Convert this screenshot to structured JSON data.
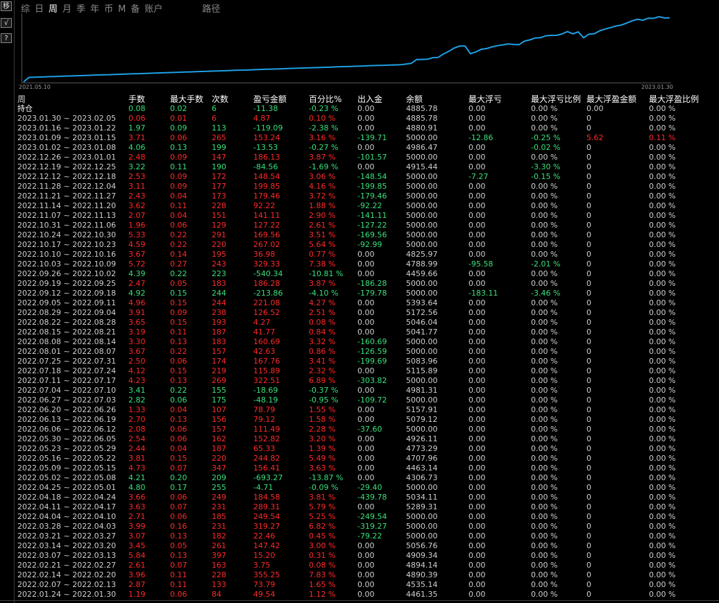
{
  "side_buttons": [
    "移",
    "√",
    "?"
  ],
  "tabs": [
    {
      "label": "综",
      "active": false
    },
    {
      "label": "日",
      "active": false
    },
    {
      "label": "周",
      "active": true
    },
    {
      "label": "月",
      "active": false
    },
    {
      "label": "季",
      "active": false
    },
    {
      "label": "年",
      "active": false
    },
    {
      "label": "币",
      "active": false
    },
    {
      "label": "M",
      "active": false
    },
    {
      "label": "备",
      "active": false
    },
    {
      "label": "账户",
      "active": false
    },
    {
      "label": "路径",
      "active": false
    }
  ],
  "chart": {
    "start_date": "2021.05.10",
    "end_date": "2023.01.30",
    "line_color": "#1ea0e6"
  },
  "columns": [
    "周",
    "手数",
    "最大手数",
    "次数",
    "盈亏金额",
    "百分比%",
    "出入金",
    "余额",
    "最大浮亏",
    "最大浮亏比例",
    "最大浮盈金额",
    "最大浮盈比例"
  ],
  "holding": {
    "label": "持仓",
    "lots": "0.08",
    "max_lots": "0.02",
    "count": "6",
    "pnl": "-11.38",
    "pct": "-0.23 %",
    "flow": "0.00",
    "balance": "4885.78",
    "max_float_loss": "0.00",
    "max_float_loss_pct": "0.00 %",
    "max_float_profit": "0.00",
    "max_float_profit_pct": "0.00 %",
    "color": "neg"
  },
  "rows": [
    [
      "2023.01.30 ~ 2023.02.05",
      "0.06",
      "0.01",
      "6",
      "4.87",
      "0.10 %",
      "0.00",
      "4885.78",
      "0.00",
      "0.00 %",
      "0",
      "0.00 %"
    ],
    [
      "2023.01.16 ~ 2023.01.22",
      "1.97",
      "0.09",
      "113",
      "-119.09",
      "-2.38 %",
      "0.00",
      "4880.91",
      "0.00",
      "0.00 %",
      "0",
      "0.00 %"
    ],
    [
      "2023.01.09 ~ 2023.01.15",
      "3.71",
      "0.06",
      "265",
      "153.24",
      "3.16 %",
      "-139.71",
      "5000.00",
      "-12.86",
      "-0.25 %",
      "5.62",
      "0.11 %"
    ],
    [
      "2023.01.02 ~ 2023.01.08",
      "4.06",
      "0.13",
      "199",
      "-13.53",
      "-0.27 %",
      "0.00",
      "4986.47",
      "0.00",
      "-0.02 %",
      "0",
      "0.00 %"
    ],
    [
      "2022.12.26 ~ 2023.01.01",
      "2.48",
      "0.09",
      "147",
      "186.13",
      "3.87 %",
      "-101.57",
      "5000.00",
      "0.00",
      "0.00 %",
      "0",
      "0.00 %"
    ],
    [
      "2022.12.19 ~ 2022.12.25",
      "3.22",
      "0.11",
      "190",
      "-84.56",
      "-1.69 %",
      "0.00",
      "4915.44",
      "0.00",
      "-3.30 %",
      "0",
      "0.00 %"
    ],
    [
      "2022.12.12 ~ 2022.12.18",
      "2.53",
      "0.09",
      "172",
      "148.54",
      "3.06 %",
      "-148.54",
      "5000.00",
      "-7.27",
      "-0.15 %",
      "0",
      "0.00 %"
    ],
    [
      "2022.11.28 ~ 2022.12.04",
      "3.11",
      "0.09",
      "177",
      "199.85",
      "4.16 %",
      "-199.85",
      "5000.00",
      "0.00",
      "0.00 %",
      "0",
      "0.00 %"
    ],
    [
      "2022.11.21 ~ 2022.11.27",
      "2.43",
      "0.04",
      "173",
      "179.46",
      "3.72 %",
      "-179.46",
      "5000.00",
      "0.00",
      "0.00 %",
      "0",
      "0.00 %"
    ],
    [
      "2022.11.14 ~ 2022.11.20",
      "3.62",
      "0.11",
      "228",
      "92.22",
      "1.88 %",
      "-92.22",
      "5000.00",
      "0.00",
      "0.00 %",
      "0",
      "0.00 %"
    ],
    [
      "2022.11.07 ~ 2022.11.13",
      "2.07",
      "0.04",
      "151",
      "141.11",
      "2.90 %",
      "-141.11",
      "5000.00",
      "0.00",
      "0.00 %",
      "0",
      "0.00 %"
    ],
    [
      "2022.10.31 ~ 2022.11.06",
      "1.96",
      "0.06",
      "129",
      "127.22",
      "2.61 %",
      "-127.22",
      "5000.00",
      "0.00",
      "0.00 %",
      "0",
      "0.00 %"
    ],
    [
      "2022.10.24 ~ 2022.10.30",
      "5.33",
      "0.22",
      "291",
      "169.56",
      "3.51 %",
      "-169.56",
      "5000.00",
      "0.00",
      "0.00 %",
      "0",
      "0.00 %"
    ],
    [
      "2022.10.17 ~ 2022.10.23",
      "4.59",
      "0.22",
      "220",
      "267.02",
      "5.64 %",
      "-92.99",
      "5000.00",
      "0.00",
      "0.00 %",
      "0",
      "0.00 %"
    ],
    [
      "2022.10.10 ~ 2022.10.16",
      "3.67",
      "0.14",
      "195",
      "36.98",
      "0.77 %",
      "0.00",
      "4825.97",
      "0.00",
      "0.00 %",
      "0",
      "0.00 %"
    ],
    [
      "2022.10.03 ~ 2022.10.09",
      "5.72",
      "0.27",
      "243",
      "329.33",
      "7.38 %",
      "0.00",
      "4788.99",
      "-95.58",
      "-2.01 %",
      "0",
      "0.00 %"
    ],
    [
      "2022.09.26 ~ 2022.10.02",
      "4.39",
      "0.22",
      "223",
      "-540.34",
      "-10.81 %",
      "0.00",
      "4459.66",
      "0.00",
      "0.00 %",
      "0",
      "0.00 %"
    ],
    [
      "2022.09.19 ~ 2022.09.25",
      "2.47",
      "0.05",
      "183",
      "186.28",
      "3.87 %",
      "-186.28",
      "5000.00",
      "0.00",
      "0.00 %",
      "0",
      "0.00 %"
    ],
    [
      "2022.09.12 ~ 2022.09.18",
      "4.92",
      "0.15",
      "244",
      "-213.86",
      "-4.10 %",
      "-179.78",
      "5000.00",
      "-183.11",
      "-3.46 %",
      "0",
      "0.00 %"
    ],
    [
      "2022.09.05 ~ 2022.09.11",
      "4.96",
      "0.15",
      "244",
      "221.08",
      "4.27 %",
      "0.00",
      "5393.64",
      "0.00",
      "0.00 %",
      "0",
      "0.00 %"
    ],
    [
      "2022.08.29 ~ 2022.09.04",
      "3.91",
      "0.09",
      "238",
      "126.52",
      "2.51 %",
      "0.00",
      "5172.56",
      "0.00",
      "0.00 %",
      "0",
      "0.00 %"
    ],
    [
      "2022.08.22 ~ 2022.08.28",
      "3.65",
      "0.15",
      "193",
      "4.27",
      "0.08 %",
      "0.00",
      "5046.04",
      "0.00",
      "0.00 %",
      "0",
      "0.00 %"
    ],
    [
      "2022.08.15 ~ 2022.08.21",
      "3.19",
      "0.11",
      "187",
      "41.77",
      "0.84 %",
      "0.00",
      "5041.77",
      "0.00",
      "0.00 %",
      "0",
      "0.00 %"
    ],
    [
      "2022.08.08 ~ 2022.08.14",
      "3.30",
      "0.13",
      "183",
      "160.69",
      "3.32 %",
      "-160.69",
      "5000.00",
      "0.00",
      "0.00 %",
      "0",
      "0.00 %"
    ],
    [
      "2022.08.01 ~ 2022.08.07",
      "3.67",
      "0.22",
      "157",
      "42.63",
      "0.86 %",
      "-126.59",
      "5000.00",
      "0.00",
      "0.00 %",
      "0",
      "0.00 %"
    ],
    [
      "2022.07.25 ~ 2022.07.31",
      "2.50",
      "0.06",
      "174",
      "167.76",
      "3.41 %",
      "-199.69",
      "5083.96",
      "0.00",
      "0.00 %",
      "0",
      "0.00 %"
    ],
    [
      "2022.07.18 ~ 2022.07.24",
      "4.12",
      "0.15",
      "219",
      "115.89",
      "2.32 %",
      "0.00",
      "5115.89",
      "0.00",
      "0.00 %",
      "0",
      "0.00 %"
    ],
    [
      "2022.07.11 ~ 2022.07.17",
      "4.23",
      "0.13",
      "269",
      "322.51",
      "6.89 %",
      "-303.82",
      "5000.00",
      "0.00",
      "0.00 %",
      "0",
      "0.00 %"
    ],
    [
      "2022.07.04 ~ 2022.07.10",
      "3.41",
      "0.22",
      "155",
      "-18.69",
      "-0.37 %",
      "0.00",
      "4981.31",
      "0.00",
      "0.00 %",
      "0",
      "0.00 %"
    ],
    [
      "2022.06.27 ~ 2022.07.03",
      "2.82",
      "0.06",
      "175",
      "-48.19",
      "-0.95 %",
      "-109.72",
      "5000.00",
      "0.00",
      "0.00 %",
      "0",
      "0.00 %"
    ],
    [
      "2022.06.20 ~ 2022.06.26",
      "1.33",
      "0.04",
      "107",
      "78.79",
      "1.55 %",
      "0.00",
      "5157.91",
      "0.00",
      "0.00 %",
      "0",
      "0.00 %"
    ],
    [
      "2022.06.13 ~ 2022.06.19",
      "2.70",
      "0.13",
      "156",
      "79.12",
      "1.58 %",
      "0.00",
      "5079.12",
      "0.00",
      "0.00 %",
      "0",
      "0.00 %"
    ],
    [
      "2022.06.06 ~ 2022.06.12",
      "2.08",
      "0.06",
      "157",
      "111.49",
      "2.28 %",
      "-37.60",
      "5000.00",
      "0.00",
      "0.00 %",
      "0",
      "0.00 %"
    ],
    [
      "2022.05.30 ~ 2022.06.05",
      "2.54",
      "0.06",
      "162",
      "152.82",
      "3.20 %",
      "0.00",
      "4926.11",
      "0.00",
      "0.00 %",
      "0",
      "0.00 %"
    ],
    [
      "2022.05.23 ~ 2022.05.29",
      "2.44",
      "0.04",
      "187",
      "65.33",
      "1.39 %",
      "0.00",
      "4773.29",
      "0.00",
      "0.00 %",
      "0",
      "0.00 %"
    ],
    [
      "2022.05.16 ~ 2022.05.22",
      "3.81",
      "0.15",
      "220",
      "244.82",
      "5.49 %",
      "0.00",
      "4707.96",
      "0.00",
      "0.00 %",
      "0",
      "0.00 %"
    ],
    [
      "2022.05.09 ~ 2022.05.15",
      "4.73",
      "0.07",
      "347",
      "156.41",
      "3.63 %",
      "0.00",
      "4463.14",
      "0.00",
      "0.00 %",
      "0",
      "0.00 %"
    ],
    [
      "2022.05.02 ~ 2022.05.08",
      "4.21",
      "0.20",
      "209",
      "-693.27",
      "-13.87 %",
      "0.00",
      "4306.73",
      "0.00",
      "0.00 %",
      "0",
      "0.00 %"
    ],
    [
      "2022.04.25 ~ 2022.05.01",
      "4.80",
      "0.17",
      "255",
      "-4.71",
      "-0.09 %",
      "-29.40",
      "5000.00",
      "0.00",
      "0.00 %",
      "0",
      "0.00 %"
    ],
    [
      "2022.04.18 ~ 2022.04.24",
      "3.66",
      "0.06",
      "249",
      "184.58",
      "3.81 %",
      "-439.78",
      "5034.11",
      "0.00",
      "0.00 %",
      "0",
      "0.00 %"
    ],
    [
      "2022.04.11 ~ 2022.04.17",
      "3.63",
      "0.07",
      "231",
      "289.31",
      "5.79 %",
      "0.00",
      "5289.31",
      "0.00",
      "0.00 %",
      "0",
      "0.00 %"
    ],
    [
      "2022.04.04 ~ 2022.04.10",
      "2.71",
      "0.06",
      "185",
      "249.54",
      "5.25 %",
      "-249.54",
      "5000.00",
      "0.00",
      "0.00 %",
      "0",
      "0.00 %"
    ],
    [
      "2022.03.28 ~ 2022.04.03",
      "3.99",
      "0.16",
      "231",
      "319.27",
      "6.82 %",
      "-319.27",
      "5000.00",
      "0.00",
      "0.00 %",
      "0",
      "0.00 %"
    ],
    [
      "2022.03.21 ~ 2022.03.27",
      "3.07",
      "0.13",
      "182",
      "22.46",
      "0.45 %",
      "-79.22",
      "5000.00",
      "0.00",
      "0.00 %",
      "0",
      "0.00 %"
    ],
    [
      "2022.03.14 ~ 2022.03.20",
      "3.45",
      "0.05",
      "261",
      "147.42",
      "3.00 %",
      "0.00",
      "5056.76",
      "0.00",
      "0.00 %",
      "0",
      "0.00 %"
    ],
    [
      "2022.03.07 ~ 2022.03.13",
      "5.84",
      "0.13",
      "397",
      "15.20",
      "0.31 %",
      "0.00",
      "4909.34",
      "0.00",
      "0.00 %",
      "0",
      "0.00 %"
    ],
    [
      "2022.02.21 ~ 2022.02.27",
      "2.61",
      "0.07",
      "163",
      "3.75",
      "0.08 %",
      "0.00",
      "4894.14",
      "0.00",
      "0.00 %",
      "0",
      "0.00 %"
    ],
    [
      "2022.02.14 ~ 2022.02.20",
      "3.96",
      "0.11",
      "228",
      "355.25",
      "7.83 %",
      "0.00",
      "4890.39",
      "0.00",
      "0.00 %",
      "0",
      "0.00 %"
    ],
    [
      "2022.02.07 ~ 2022.02.13",
      "2.87",
      "0.11",
      "133",
      "73.79",
      "1.65 %",
      "0.00",
      "4535.14",
      "0.00",
      "0.00 %",
      "0",
      "0.00 %"
    ],
    [
      "2022.01.24 ~ 2022.01.30",
      "1.19",
      "0.06",
      "84",
      "49.54",
      "1.12 %",
      "0.00",
      "4461.35",
      "0.00",
      "0.00 %",
      "0",
      "0.00 %"
    ]
  ]
}
